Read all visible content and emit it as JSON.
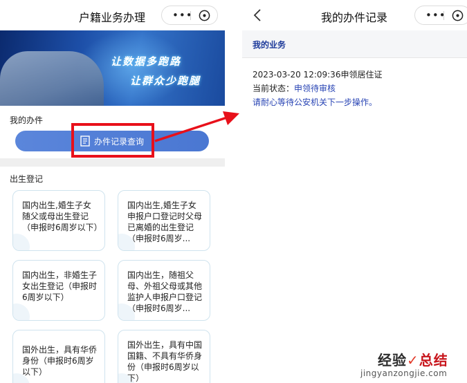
{
  "left": {
    "title": "户籍业务办理",
    "capsule": {
      "more": "•••"
    },
    "banner": {
      "line1": "让数据多跑路",
      "line2": "让群众少跑腿"
    },
    "my_section": "我的办件",
    "record_button": "办件记录查询",
    "birth_section": "出生登记",
    "cards": [
      {
        "text": "国内出生,婚生子女随父或母出生登记（申报时6周岁以下）"
      },
      {
        "text": "国内出生,婚生子女申报户口登记时父母已离婚的出生登记（申报时6周岁..."
      },
      {
        "text": "国内出生，非婚生子女出生登记（申报时6周岁以下）"
      },
      {
        "text": "国内出生，随祖父母、外祖父母或其他监护人申报户口登记（申报时6周岁..."
      },
      {
        "text": "国外出生，具有华侨身份（申报时6周岁以下）"
      },
      {
        "text": "国外出生，具有中国国籍、不具有华侨身份（申报时6周岁以下）"
      }
    ]
  },
  "right": {
    "title": "我的办件记录",
    "capsule": {
      "more": "•••"
    },
    "section": "我的业务",
    "record": {
      "datetime_type": "2023-03-20 12:09:36申领居住证",
      "status_label": "当前状态：",
      "status_value": "申领待审核",
      "note": "请耐心等待公安机关下一步操作。"
    }
  },
  "watermark": {
    "main_a": "经验",
    "main_check": "✓",
    "main_b": "总结",
    "sub": "jingyanzongjie.com"
  },
  "colors": {
    "accent_blue": "#2844b4",
    "button_blue": "#4a77d2",
    "highlight_red": "#e8101a"
  }
}
